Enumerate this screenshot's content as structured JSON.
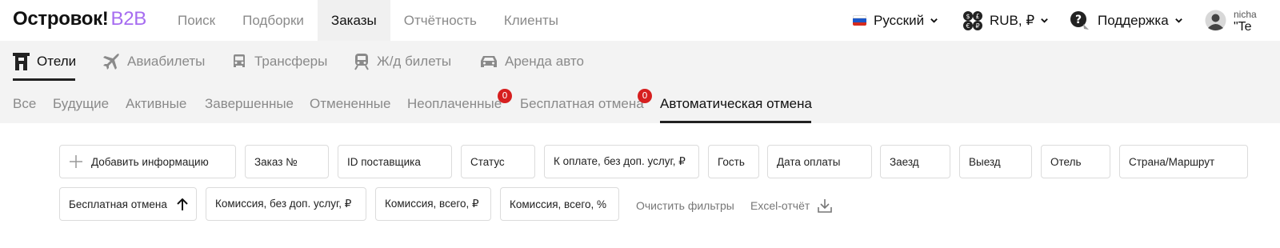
{
  "logo": {
    "name": "Островок!",
    "suffix": "B2B"
  },
  "topnav": [
    {
      "label": "Поиск"
    },
    {
      "label": "Подборки"
    },
    {
      "label": "Заказы",
      "active": true
    },
    {
      "label": "Отчётность"
    },
    {
      "label": "Клиенты"
    }
  ],
  "header_right": {
    "language": "Русский",
    "currency": "RUB, ₽",
    "support": "Поддержка",
    "user_name": "nicha",
    "user_company": "\"Te"
  },
  "products": [
    {
      "label": "Отели",
      "icon": "hotel-icon",
      "active": true
    },
    {
      "label": "Авиабилеты",
      "icon": "plane-icon"
    },
    {
      "label": "Трансферы",
      "icon": "car-icon"
    },
    {
      "label": "Ж/д билеты",
      "icon": "train-icon"
    },
    {
      "label": "Аренда авто",
      "icon": "rental-car-icon"
    }
  ],
  "tabs": [
    {
      "label": "Все"
    },
    {
      "label": "Будущие"
    },
    {
      "label": "Активные"
    },
    {
      "label": "Завершенные"
    },
    {
      "label": "Отмененные"
    },
    {
      "label": "Неоплаченные",
      "badge": "0"
    },
    {
      "label": "Бесплатная отмена",
      "badge": "0"
    },
    {
      "label": "Автоматическая отмена",
      "active": true
    }
  ],
  "filters_row1": [
    {
      "label": "Добавить информацию",
      "icon": "plus-icon"
    },
    {
      "label": "Заказ №"
    },
    {
      "label": "ID поставщика"
    },
    {
      "label": "Статус"
    },
    {
      "label": "К оплате, без доп. услуг, ₽"
    },
    {
      "label": "Гость"
    },
    {
      "label": "Дата оплаты"
    },
    {
      "label": "Заезд"
    },
    {
      "label": "Выезд"
    },
    {
      "label": "Отель"
    },
    {
      "label": "Страна/Маршрут"
    }
  ],
  "filters_row2": [
    {
      "label": "Бесплатная отмена",
      "icon": "arrow-up-icon"
    },
    {
      "label": "Комиссия, без доп. услуг, ₽"
    },
    {
      "label": "Комиссия, всего, ₽"
    },
    {
      "label": "Комиссия, всего, %"
    }
  ],
  "actions": {
    "clear_filters": "Очистить фильтры",
    "excel_report": "Excel-отчёт"
  },
  "colors": {
    "accent": "#a66cf0",
    "badge": "#d61f1f",
    "tab_background": "#f3f3f3"
  }
}
